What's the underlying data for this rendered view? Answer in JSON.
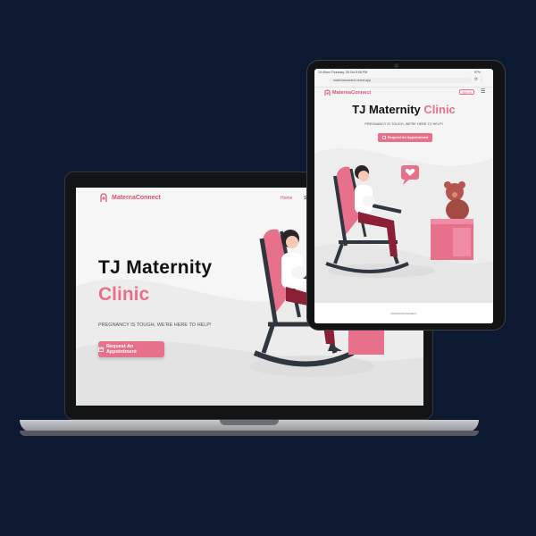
{
  "colors": {
    "background": "#0c1930",
    "accent": "#e7708b",
    "brand_text": "#d94f6f",
    "title_text": "#111111"
  },
  "laptop": {
    "brand": "MaternaConnect",
    "nav": {
      "home": "Home",
      "services_partial": "Se"
    },
    "title_line1": "TJ Maternity",
    "title_line2": "Clinic",
    "tagline": "PREGNANCY IS TOUGH, WE'RE HERE TO HELP!",
    "cta": "Request An Appointment",
    "icons": [
      "logo-icon",
      "calendar-icon"
    ]
  },
  "tablet": {
    "status_left": "10:45am Thursday, 26 Oct 5:06 PM",
    "status_right": "57%",
    "url": "maternaconnect.vercel.app",
    "brand": "MaternaConnect",
    "signin": "Sign In",
    "title_main": "TJ Maternity",
    "title_accent": "Clinic",
    "tagline": "PREGNANCY IS TOUGH, WE'RE HERE TO HELP!",
    "cta": "Request An Appointment",
    "footer": "MATERNACONNECT",
    "icons": [
      "logo-icon",
      "menu-icon",
      "calendar-icon",
      "refresh-icon",
      "more-icon",
      "heart-chat-icon"
    ]
  }
}
